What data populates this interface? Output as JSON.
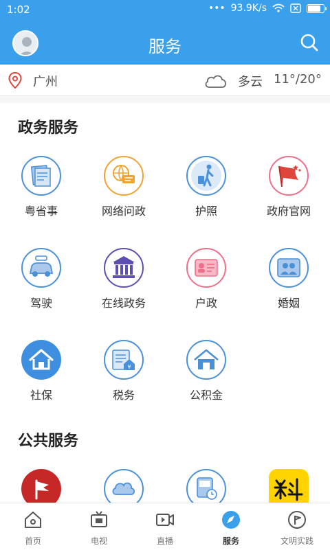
{
  "status_bar": {
    "time": "1:02",
    "net_speed": "93.9K/s",
    "battery_level": 0.85
  },
  "header": {
    "title": "服务"
  },
  "location": {
    "city": "广州",
    "weather": "多云",
    "temperature": "11°/20°"
  },
  "sections": {
    "government": {
      "title": "政务服务",
      "items": [
        {
          "label": "粤省事",
          "icon": "document-stack-icon"
        },
        {
          "label": "网络问政",
          "icon": "globe-chat-icon"
        },
        {
          "label": "护照",
          "icon": "traveler-luggage-icon"
        },
        {
          "label": "政府官网",
          "icon": "red-flag-icon"
        },
        {
          "label": "驾驶",
          "icon": "car-icon"
        },
        {
          "label": "在线政务",
          "icon": "government-building-icon"
        },
        {
          "label": "户政",
          "icon": "id-card-icon"
        },
        {
          "label": "婚姻",
          "icon": "couple-certificate-icon"
        },
        {
          "label": "社保",
          "icon": "home-shield-icon"
        },
        {
          "label": "税务",
          "icon": "tax-house-icon"
        },
        {
          "label": "公积金",
          "icon": "house-icon"
        }
      ]
    },
    "public": {
      "title": "公共服务",
      "items": [
        {
          "label": "",
          "icon": "red-flag-app-icon"
        },
        {
          "label": "",
          "icon": "cloud-icon"
        },
        {
          "label": "",
          "icon": "bus-clock-icon"
        },
        {
          "label": "",
          "icon": "mi-liao-app-icon"
        }
      ]
    }
  },
  "bottom_nav": [
    {
      "label": "首页",
      "icon": "home-icon"
    },
    {
      "label": "电视",
      "icon": "tv-icon"
    },
    {
      "label": "直播",
      "icon": "live-video-icon"
    },
    {
      "label": "服务",
      "icon": "compass-icon",
      "active": true
    },
    {
      "label": "文明实践",
      "icon": "flag-circle-icon"
    }
  ],
  "colors": {
    "primary": "#3aa0ec",
    "accent_red": "#e0453c",
    "ring_blue": "#4a90d9",
    "ring_orange": "#f1a32f",
    "ring_pink": "#ee6f8a"
  }
}
